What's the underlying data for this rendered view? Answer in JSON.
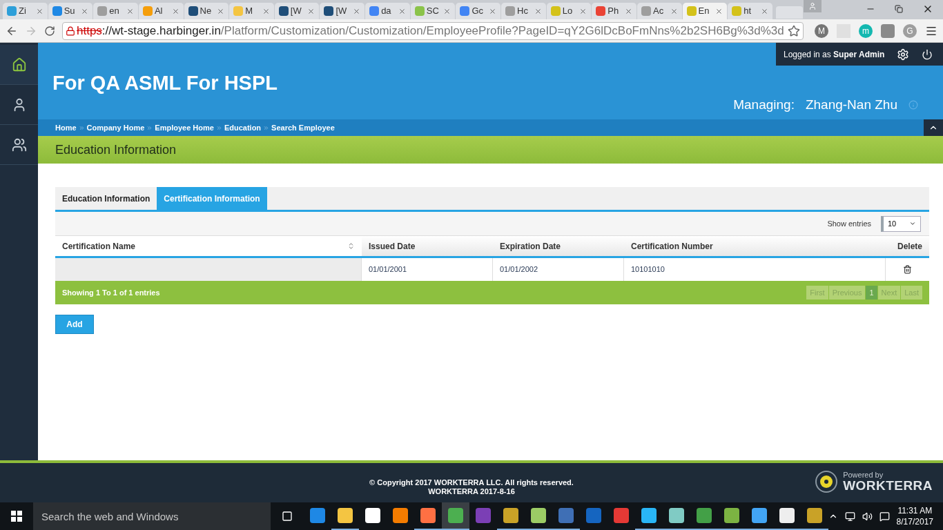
{
  "browser_tabs": [
    {
      "label": "Zi",
      "selected": false,
      "color": "#2d9fd9"
    },
    {
      "label": "Su",
      "selected": false,
      "color": "#1e88e5"
    },
    {
      "label": "en",
      "selected": false,
      "color": "#9e9e9e"
    },
    {
      "label": "Al",
      "selected": false,
      "color": "#f59e0b"
    },
    {
      "label": "Ne",
      "selected": false,
      "color": "#1f4e79"
    },
    {
      "label": "M",
      "selected": false,
      "color": "#f4c542"
    },
    {
      "label": "[W",
      "selected": false,
      "color": "#1f4e79"
    },
    {
      "label": "[W",
      "selected": false,
      "color": "#1f4e79"
    },
    {
      "label": "da",
      "selected": false,
      "color": "#4285f4"
    },
    {
      "label": "SC",
      "selected": false,
      "color": "#8bc34a"
    },
    {
      "label": "Gc",
      "selected": false,
      "color": "#4285f4"
    },
    {
      "label": "Hc",
      "selected": false,
      "color": "#9e9e9e"
    },
    {
      "label": "Lo",
      "selected": false,
      "color": "#d4c21a"
    },
    {
      "label": "Ph",
      "selected": false,
      "color": "#ea4335"
    },
    {
      "label": "Ac",
      "selected": false,
      "color": "#9e9e9e"
    },
    {
      "label": "En",
      "selected": true,
      "color": "#d4c21a"
    },
    {
      "label": "ht",
      "selected": false,
      "color": "#d4c21a"
    }
  ],
  "address_bar": {
    "scheme": "https",
    "host": "://wt-stage.harbinger.in",
    "path": "/Platform/Customization/Customization/EmployeeProfile?PageID=qY2G6lDcBoFmNns%2b2SH6Bg%3d%3d"
  },
  "extensions": [
    {
      "kind": "letter",
      "letter": "M",
      "color": "#757575"
    },
    {
      "kind": "picture",
      "color": "#e0e0e0"
    },
    {
      "kind": "letter",
      "letter": "m",
      "color": "#14b8b0"
    },
    {
      "kind": "square",
      "color": "#8a8a8a"
    },
    {
      "kind": "letter",
      "letter": "G",
      "color": "#9e9e9e"
    }
  ],
  "sidebar": {
    "items": [
      {
        "kind": "home",
        "selected": true
      },
      {
        "kind": "person",
        "selected": false
      },
      {
        "kind": "group",
        "selected": false
      }
    ]
  },
  "header": {
    "title": "For QA ASML For HSPL",
    "logged_in": "Logged in as **Super Admin**",
    "managing_label": "Managing:",
    "managing_name": "Zhang-Nan Zhu"
  },
  "breadcrumbs": [
    "Home",
    "Company Home",
    "Employee Home",
    "Education",
    "Search Employee"
  ],
  "section_title": "Education Information",
  "tabs": [
    {
      "label": "Education Information",
      "selected": false
    },
    {
      "label": "Certification Information",
      "selected": true
    }
  ],
  "show_entries": {
    "label": "Show entries",
    "value": "10"
  },
  "table": {
    "columns": [
      "Certification Name",
      "Issued Date",
      "Expiration Date",
      "Certification Number",
      "Delete"
    ],
    "rows": [
      {
        "issued_date": "01/01/2001",
        "expiration_date": "01/01/2002",
        "certification_number": "10101010"
      }
    ]
  },
  "table_info": "Showing 1 To 1 of 1 entries",
  "pager": [
    {
      "label": "First",
      "selected": false
    },
    {
      "label": "Previous",
      "selected": false
    },
    {
      "label": "1",
      "selected": true
    },
    {
      "label": "Next",
      "selected": false
    },
    {
      "label": "Last",
      "selected": false
    }
  ],
  "add_button": "Add",
  "footer": {
    "copyright": "© Copyright 2017 WORKTERRA LLC. All rights reserved.",
    "version": "WORKTERRA 2017-8-16",
    "powered_by": "Powered by",
    "brand": "WORKTERRA"
  },
  "taskbar": {
    "search_placeholder": "Search the web and Windows",
    "time": "11:31 AM",
    "date": "8/17/2017",
    "apps": [
      {
        "color": "#1e88e5",
        "running": false,
        "selected": false
      },
      {
        "color": "#f4c542",
        "running": true,
        "selected": false
      },
      {
        "color": "#ffffff",
        "running": false,
        "selected": false
      },
      {
        "color": "#f57c00",
        "running": false,
        "selected": false
      },
      {
        "color": "#ff7043",
        "running": true,
        "selected": false
      },
      {
        "color": "#4caf50",
        "running": true,
        "selected": true
      },
      {
        "color": "#7b3fb5",
        "running": false,
        "selected": false
      },
      {
        "color": "#c9a227",
        "running": true,
        "selected": false
      },
      {
        "color": "#9ccc65",
        "running": true,
        "selected": false
      },
      {
        "color": "#3f6fb5",
        "running": true,
        "selected": false
      },
      {
        "color": "#1565c0",
        "running": false,
        "selected": false
      },
      {
        "color": "#e53935",
        "running": false,
        "selected": false
      },
      {
        "color": "#29b6f6",
        "running": true,
        "selected": false
      },
      {
        "color": "#80cbc4",
        "running": true,
        "selected": false
      },
      {
        "color": "#43a047",
        "running": true,
        "selected": false
      },
      {
        "color": "#7cb342",
        "running": true,
        "selected": false
      },
      {
        "color": "#42a5f5",
        "running": true,
        "selected": false
      },
      {
        "color": "#eeeeee",
        "running": true,
        "selected": false
      },
      {
        "color": "#c9a227",
        "running": true,
        "selected": false
      }
    ]
  }
}
